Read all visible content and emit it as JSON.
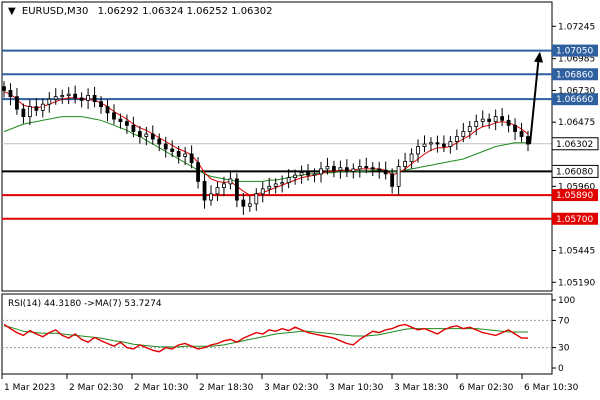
{
  "chart_data": {
    "type": "candlestick",
    "symbol": "EURUSD,M30",
    "ohlc_label": "1.06292 1.06324 1.06252 1.06302",
    "current_price": 1.06302,
    "price_ticks": [
      1.07245,
      1.06985,
      1.0673,
      1.06475,
      1.0596,
      1.05445,
      1.0519
    ],
    "price_ylim": [
      1.0512,
      1.0744
    ],
    "levels": [
      {
        "value": 1.0705,
        "label": "1.07050",
        "color": "#2e5f9e"
      },
      {
        "value": 1.0686,
        "label": "1.06860",
        "color": "#2e5f9e"
      },
      {
        "value": 1.0666,
        "label": "1.06660",
        "color": "#2e5f9e"
      },
      {
        "value": 1.0608,
        "label": "1.06080",
        "color": "#000000"
      },
      {
        "value": 1.0589,
        "label": "1.05890",
        "color": "#e00000"
      },
      {
        "value": 1.057,
        "label": "1.05700",
        "color": "#e00000"
      }
    ],
    "arrow": {
      "from_value": 1.063,
      "to_value": 1.0705
    },
    "time_labels": [
      "1 Mar 2023",
      "2 Mar 02:30",
      "2 Mar 10:30",
      "2 Mar 18:30",
      "3 Mar 02:30",
      "3 Mar 10:30",
      "3 Mar 18:30",
      "6 Mar 02:30",
      "6 Mar 10:30"
    ],
    "close_approx": [
      1.0673,
      1.0668,
      1.0658,
      1.0652,
      1.066,
      1.0657,
      1.0662,
      1.0666,
      1.0668,
      1.0669,
      1.067,
      1.0667,
      1.0665,
      1.0669,
      1.0664,
      1.066,
      1.0655,
      1.065,
      1.0648,
      1.0645,
      1.064,
      1.0636,
      1.0638,
      1.0634,
      1.063,
      1.0626,
      1.0624,
      1.062,
      1.0622,
      1.0615,
      1.06,
      1.0585,
      1.059,
      1.0595,
      1.0598,
      1.0602,
      1.0585,
      1.058,
      1.0582,
      1.059,
      1.0594,
      1.0596,
      1.0598,
      1.0599,
      1.0603,
      1.0605,
      1.0607,
      1.0605,
      1.0606,
      1.061,
      1.0612,
      1.0609,
      1.0611,
      1.0608,
      1.061,
      1.0612,
      1.0611,
      1.061,
      1.0609,
      1.0606,
      1.0596,
      1.0612,
      1.0616,
      1.0622,
      1.0628,
      1.063,
      1.0631,
      1.063,
      1.0628,
      1.0632,
      1.0636,
      1.064,
      1.0644,
      1.0648,
      1.065,
      1.0648,
      1.0652,
      1.0649,
      1.0645,
      1.064,
      1.0636,
      1.063
    ],
    "ma_fast_approx": [
      1.0672,
      1.067,
      1.0666,
      1.0661,
      1.066,
      1.0659,
      1.066,
      1.0662,
      1.0664,
      1.0666,
      1.0667,
      1.0667,
      1.0666,
      1.0666,
      1.0665,
      1.0663,
      1.066,
      1.0656,
      1.0653,
      1.065,
      1.0646,
      1.0643,
      1.0641,
      1.0638,
      1.0635,
      1.0632,
      1.0629,
      1.0626,
      1.0624,
      1.0621,
      1.0615,
      1.0607,
      1.0602,
      1.06,
      1.0599,
      1.06,
      1.0596,
      1.0592,
      1.0589,
      1.059,
      1.0591,
      1.0593,
      1.0595,
      1.0597,
      1.0599,
      1.0601,
      1.0603,
      1.0604,
      1.0605,
      1.0606,
      1.0608,
      1.0608,
      1.0609,
      1.0609,
      1.0609,
      1.061,
      1.061,
      1.061,
      1.061,
      1.0609,
      1.0605,
      1.0607,
      1.061,
      1.0614,
      1.0618,
      1.0622,
      1.0625,
      1.0627,
      1.0627,
      1.0628,
      1.0631,
      1.0634,
      1.0637,
      1.0641,
      1.0644,
      1.0645,
      1.0647,
      1.0648,
      1.0647,
      1.0645,
      1.0642,
      1.0638
    ],
    "ma_slow_approx": [
      1.064,
      1.0642,
      1.0644,
      1.0646,
      1.0647,
      1.0648,
      1.0649,
      1.065,
      1.0651,
      1.0652,
      1.0652,
      1.0652,
      1.0652,
      1.0651,
      1.065,
      1.0649,
      1.0647,
      1.0645,
      1.0643,
      1.0641,
      1.0638,
      1.0636,
      1.0633,
      1.063,
      1.0627,
      1.0624,
      1.0621,
      1.0618,
      1.0615,
      1.0612,
      1.0609,
      1.0606,
      1.0604,
      1.0603,
      1.0602,
      1.0601,
      1.06,
      1.06,
      1.06,
      1.06,
      1.06,
      1.0601,
      1.0601,
      1.0602,
      1.0603,
      1.0604,
      1.0605,
      1.0606,
      1.0606,
      1.0607,
      1.0607,
      1.0607,
      1.0608,
      1.0608,
      1.0608,
      1.0608,
      1.0608,
      1.0609,
      1.0609,
      1.0609,
      1.0608,
      1.0608,
      1.0609,
      1.061,
      1.0611,
      1.0612,
      1.0613,
      1.0614,
      1.0615,
      1.0616,
      1.0617,
      1.0618,
      1.062,
      1.0622,
      1.0624,
      1.0626,
      1.0628,
      1.0629,
      1.063,
      1.0631,
      1.0631,
      1.0631
    ],
    "rsi": {
      "label": "RSI(14) 44.3180 ->MA(7) 53.7274",
      "ticks": [
        100,
        70,
        30,
        0
      ],
      "levels": [
        70,
        30
      ],
      "ylim": [
        0,
        100
      ],
      "values_approx": [
        64,
        58,
        52,
        48,
        55,
        50,
        46,
        52,
        56,
        48,
        44,
        50,
        42,
        38,
        45,
        40,
        36,
        32,
        38,
        30,
        28,
        34,
        30,
        26,
        24,
        30,
        28,
        34,
        36,
        32,
        28,
        30,
        34,
        36,
        40,
        42,
        38,
        44,
        48,
        52,
        50,
        56,
        54,
        58,
        55,
        60,
        56,
        52,
        50,
        48,
        46,
        44,
        40,
        36,
        34,
        42,
        48,
        54,
        52,
        56,
        58,
        62,
        64,
        60,
        56,
        58,
        54,
        50,
        56,
        60,
        62,
        58,
        60,
        56,
        52,
        50,
        48,
        52,
        56,
        50,
        44,
        44
      ],
      "ma_values_approx": [
        62,
        60,
        57,
        54,
        53,
        52,
        51,
        51,
        51,
        50,
        49,
        48,
        47,
        46,
        45,
        44,
        42,
        40,
        39,
        37,
        35,
        34,
        33,
        32,
        31,
        31,
        31,
        31,
        32,
        32,
        32,
        32,
        32,
        33,
        34,
        36,
        38,
        40,
        42,
        44,
        46,
        48,
        50,
        51,
        52,
        53,
        54,
        54,
        53,
        52,
        51,
        50,
        49,
        48,
        47,
        47,
        47,
        48,
        49,
        51,
        53,
        55,
        57,
        58,
        58,
        58,
        58,
        58,
        58,
        58,
        58,
        58,
        58,
        58,
        57,
        56,
        55,
        54,
        53,
        53,
        53,
        53
      ]
    }
  },
  "colors": {
    "bull_candle": "#000000",
    "bear_candle": "#000000",
    "ma_fast": "#e00000",
    "ma_slow": "#1f8a1f",
    "ma_short_blue": "#2e5f9e",
    "rsi_line": "#e00000",
    "rsi_ma": "#1f8a1f",
    "current_price_bg": "#ffffff"
  }
}
